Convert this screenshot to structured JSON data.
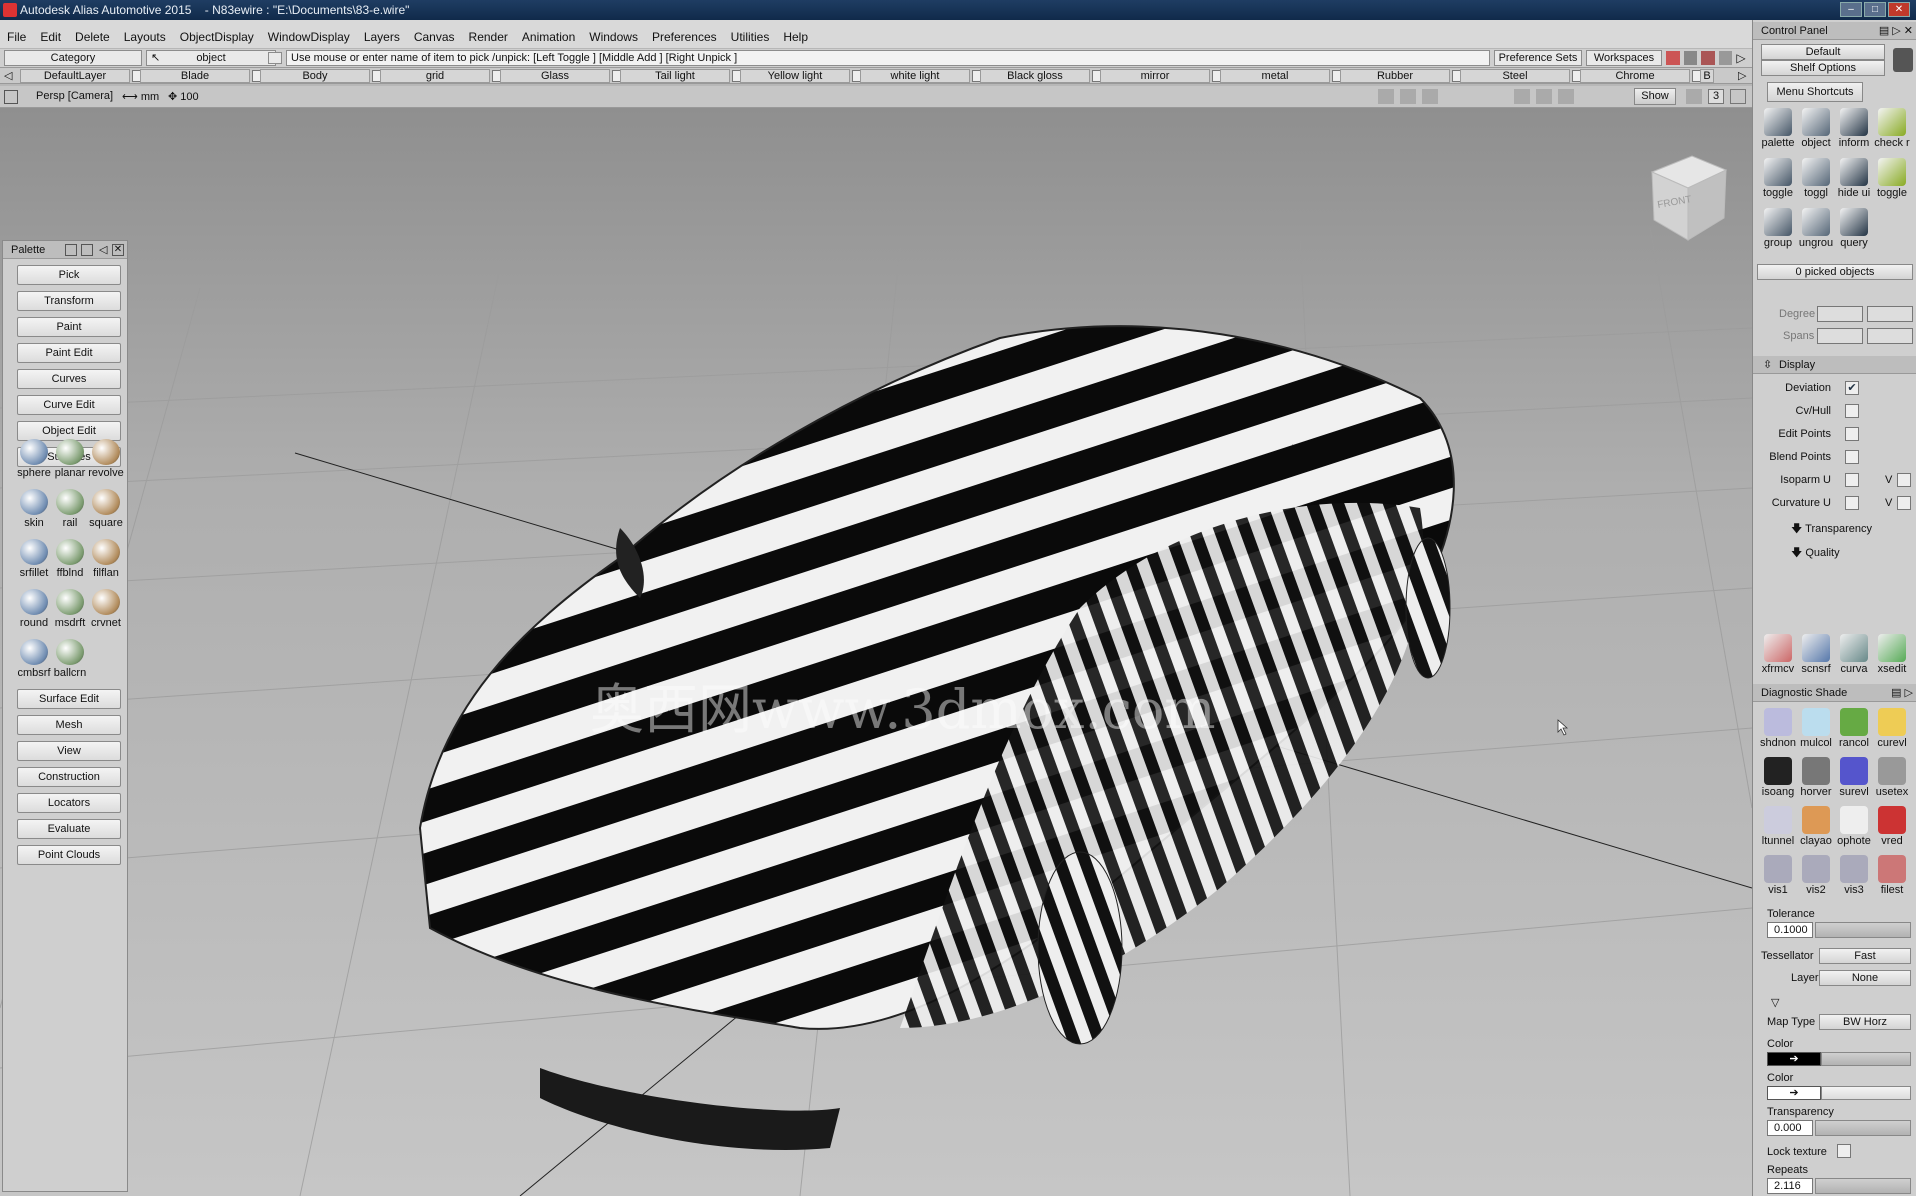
{
  "app": {
    "title": "Autodesk Alias Automotive 2015",
    "document": "- N83ewire : \"E:\\Documents\\83-e.wire\""
  },
  "menu": [
    "File",
    "Edit",
    "Delete",
    "Layouts",
    "ObjectDisplay",
    "WindowDisplay",
    "Layers",
    "Canvas",
    "Render",
    "Animation",
    "Windows",
    "Preferences",
    "Utilities",
    "Help"
  ],
  "cmd": {
    "category": "Category",
    "object": "object",
    "prompt": "Use mouse or enter name of item to pick /unpick: [Left Toggle ] [Middle Add ] [Right Unpick ]",
    "pref_sets": "Preference Sets",
    "workspaces": "Workspaces"
  },
  "shelf": [
    "DefaultLayer",
    "Blade",
    "Body",
    "grid",
    "Glass",
    "Tail light",
    "Yellow light",
    "white light",
    "Black gloss",
    "mirror",
    "metal",
    "Rubber",
    "Steel",
    "Chrome",
    "B"
  ],
  "view": {
    "label": "Persp [Camera]",
    "unit": "mm",
    "value": "100",
    "show": "Show",
    "num": "3"
  },
  "watermark": "奥西网www.3dmox.com",
  "viewcube": "FRONT",
  "palette": {
    "title": "Palette",
    "top": [
      "Pick",
      "Transform",
      "Paint",
      "Paint Edit",
      "Curves",
      "Curve Edit",
      "Object Edit",
      "Surfaces"
    ],
    "tools": [
      [
        "sphere",
        "planar",
        "revolve"
      ],
      [
        "skin",
        "rail",
        "square"
      ],
      [
        "srfillet",
        "ffblnd",
        "filflan"
      ],
      [
        "round",
        "msdrft",
        "crvnet"
      ],
      [
        "cmbsrf",
        "ballcrn",
        ""
      ]
    ],
    "bottom": [
      "Surface Edit",
      "Mesh",
      "View",
      "Construction",
      "Locators",
      "Evaluate",
      "Point Clouds"
    ]
  },
  "control": {
    "title": "Control Panel",
    "default": "Default",
    "shelf_options": "Shelf Options",
    "menu_shortcuts": "Menu Shortcuts",
    "shortcuts": [
      [
        "palette",
        "object",
        "inform",
        "check r"
      ],
      [
        "toggle",
        "toggl",
        "hide ui",
        "toggle"
      ],
      [
        "group",
        "ungrou",
        "query",
        ""
      ]
    ],
    "picked": "0 picked objects",
    "degree": "Degree",
    "spans": "Spans",
    "display": "Display",
    "display_items": [
      {
        "label": "Deviation",
        "checked": true
      },
      {
        "label": "Cv/Hull",
        "checked": false
      },
      {
        "label": "Edit Points",
        "checked": false
      },
      {
        "label": "Blend Points",
        "checked": false
      },
      {
        "label": "Isoparm U",
        "checked": false
      },
      {
        "label": "Curvature U",
        "checked": false
      }
    ],
    "v_label": "V",
    "transparency": "Transparency",
    "quality": "Quality",
    "shelf2": [
      "xfrmcv",
      "scnsrf",
      "curva",
      "xsedit"
    ],
    "diag_title": "Diagnostic Shade",
    "diag": [
      [
        "shdnon",
        "mulcol",
        "rancol",
        "curevl"
      ],
      [
        "isoang",
        "horver",
        "surevl",
        "usetex"
      ],
      [
        "ltunnel",
        "clayao",
        "ophote",
        "vred"
      ],
      [
        "vis1",
        "vis2",
        "vis3",
        "filest"
      ]
    ],
    "tolerance_label": "Tolerance",
    "tolerance": "0.1000",
    "tessellator_label": "Tessellator",
    "tessellator": "Fast",
    "layer_label": "Layer",
    "layer": "None",
    "maptype_label": "Map Type",
    "maptype": "BW Horz",
    "color1": "Color",
    "color2": "Color",
    "transp_label": "Transparency",
    "transp": "0.000",
    "lock": "Lock texture",
    "repeats_label": "Repeats",
    "repeats": "2.116"
  }
}
